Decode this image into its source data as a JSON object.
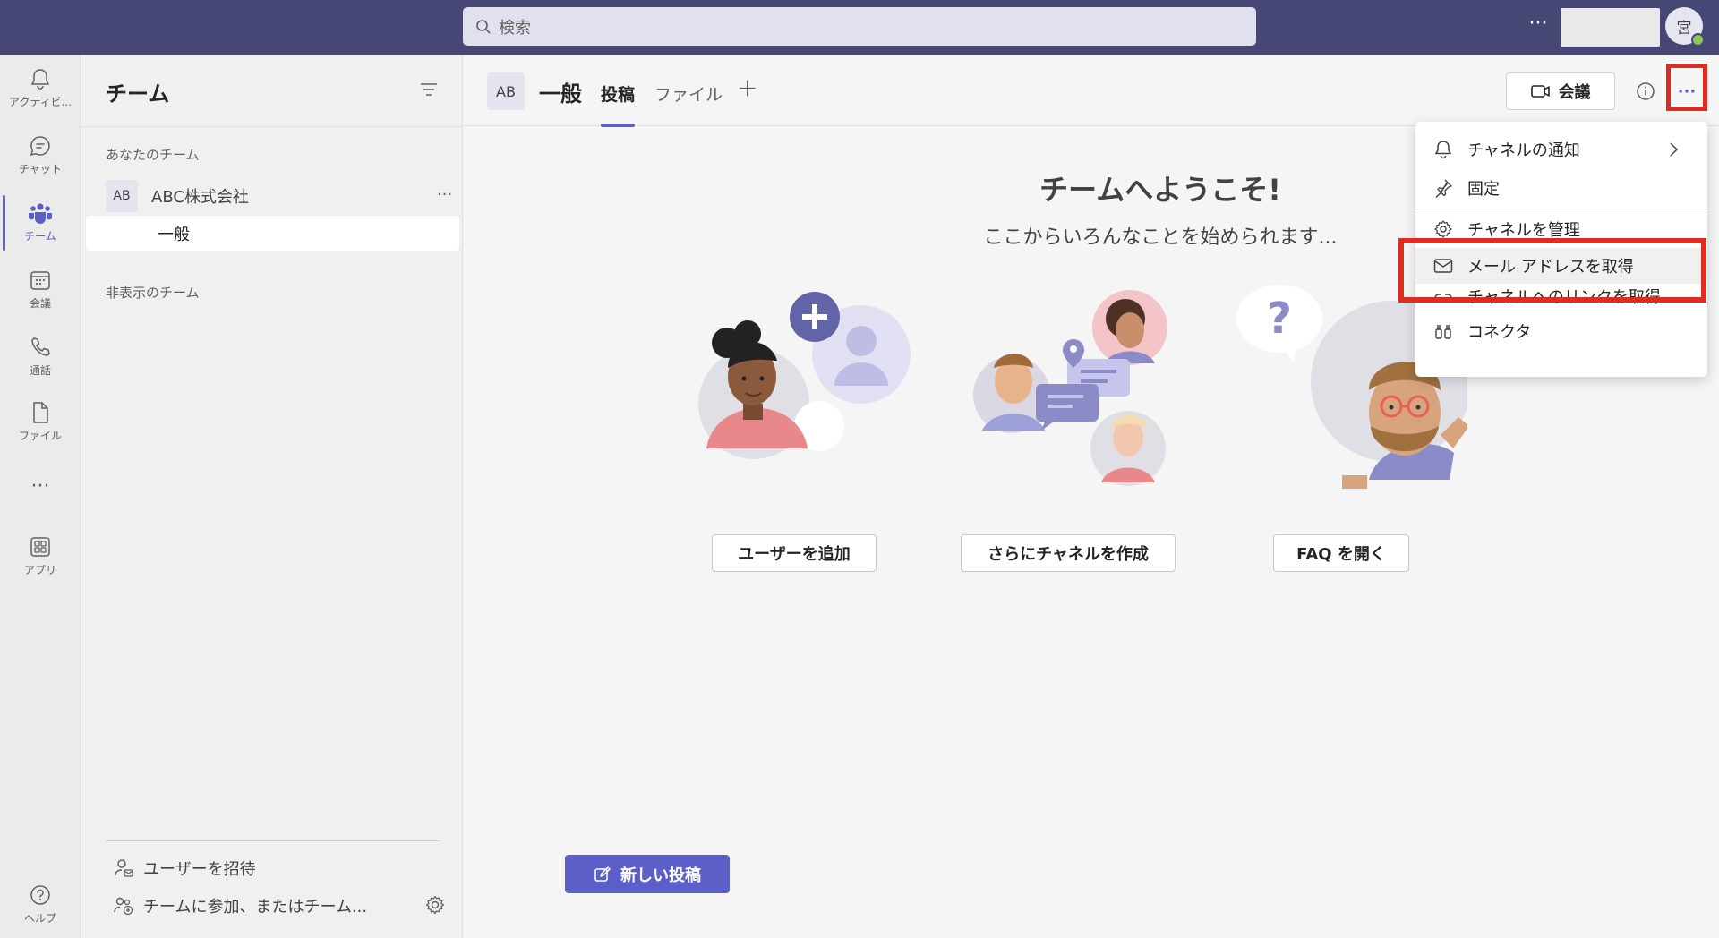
{
  "topbar": {
    "search_placeholder": "検索",
    "more_label": "···",
    "avatar_initial": "宮"
  },
  "rail": {
    "items": [
      {
        "label": "アクティビ...",
        "icon": "bell-icon"
      },
      {
        "label": "チャット",
        "icon": "chat-icon"
      },
      {
        "label": "チーム",
        "icon": "teams-icon",
        "active": true
      },
      {
        "label": "会議",
        "icon": "calendar-icon"
      },
      {
        "label": "通話",
        "icon": "phone-icon"
      },
      {
        "label": "ファイル",
        "icon": "file-icon"
      },
      {
        "label": "···",
        "icon": "more-icon"
      },
      {
        "label": "アプリ",
        "icon": "apps-icon"
      },
      {
        "label": "ヘルプ",
        "icon": "help-icon"
      }
    ]
  },
  "pane": {
    "title": "チーム",
    "your_teams_label": "あなたのチーム",
    "team": {
      "initials": "AB",
      "name": "ABC株式会社",
      "more": "···"
    },
    "channel": "一般",
    "hidden_teams_label": "非表示のチーム",
    "invite_label": "ユーザーを招待",
    "join_label": "チームに参加、またはチーム..."
  },
  "channel_header": {
    "initials": "AB",
    "title": "一般",
    "tabs": [
      {
        "label": "投稿",
        "active": true
      },
      {
        "label": "ファイル",
        "active": false
      }
    ],
    "add_tab": "+",
    "meet_label": "会議",
    "more_label": "···"
  },
  "welcome": {
    "title": "チームへようこそ!",
    "subtitle": "ここからいろんなことを始められます...",
    "actions": [
      "ユーザーを追加",
      "さらにチャネルを作成",
      "FAQ を開く"
    ],
    "new_post": "新しい投稿"
  },
  "menu": {
    "items": [
      {
        "label": "チャネルの通知",
        "icon": "bell-icon",
        "has_submenu": true
      },
      {
        "label": "固定",
        "icon": "pin-icon"
      },
      {
        "label": "チャネルを管理",
        "icon": "gear-icon"
      },
      {
        "label": "メール アドレスを取得",
        "icon": "mail-icon",
        "highlighted": true
      },
      {
        "label": "チャネルへのリンクを取得",
        "icon": "link-icon"
      },
      {
        "label": "コネクタ",
        "icon": "connector-icon"
      }
    ]
  },
  "colors": {
    "topbar": "#464775",
    "accent": "#5b5fc7",
    "highlight_box": "#e02b20"
  }
}
